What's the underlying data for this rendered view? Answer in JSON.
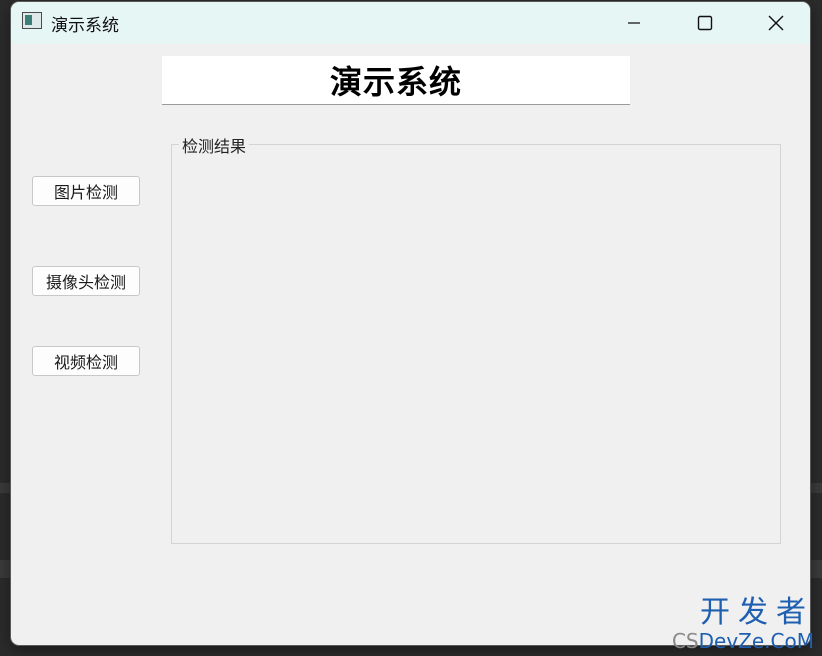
{
  "window": {
    "title": "演示系统"
  },
  "header": {
    "heading": "演示系统"
  },
  "sidebar": {
    "buttons": [
      {
        "label": "图片检测"
      },
      {
        "label": "摄像头检测"
      },
      {
        "label": "视频检测"
      }
    ]
  },
  "result_group": {
    "label": "检测结果"
  },
  "watermark": {
    "line1": "开发者",
    "line2_prefix": "CS",
    "line2": "DevZe.CoM"
  },
  "colors": {
    "titlebar": "#e6f6f4",
    "window_bg": "#f0f0f0",
    "watermark": "#1f5fb0"
  }
}
